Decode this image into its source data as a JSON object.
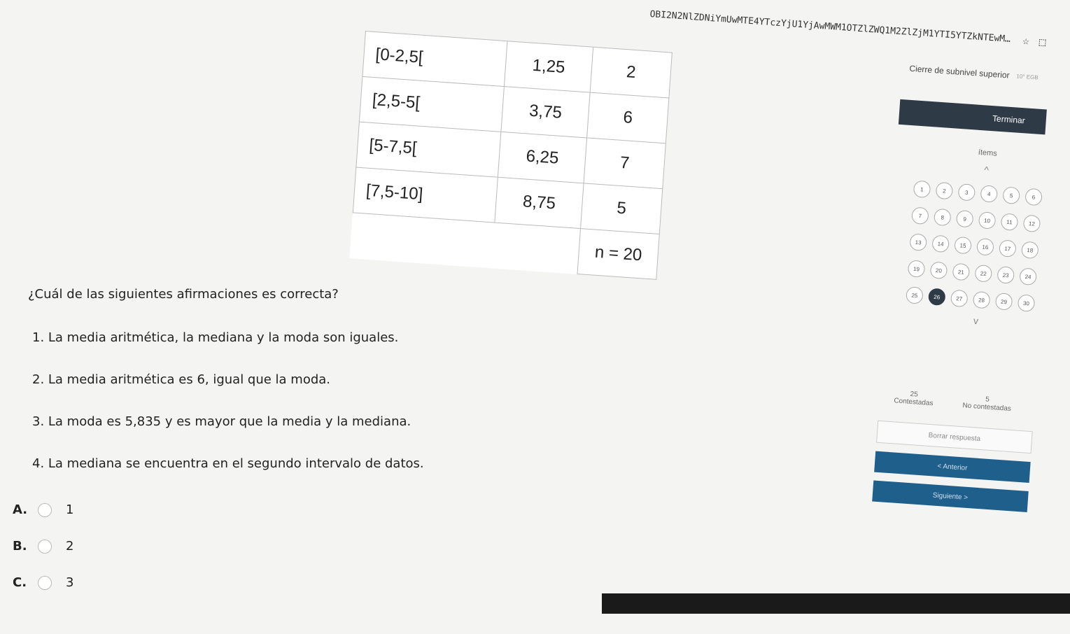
{
  "browser": {
    "url": "OBI2N2NlZDNiYmUwMTE4YTczYjU1YjAwMWM1OTZlZWQ1M2ZlZjM1YTI5YTZkNTEwMDk..."
  },
  "table": {
    "rows": [
      {
        "interval": "[0-2,5[",
        "mark": "1,25",
        "freq": "2"
      },
      {
        "interval": "[2,5-5[",
        "mark": "3,75",
        "freq": "6"
      },
      {
        "interval": "[5-7,5[",
        "mark": "6,25",
        "freq": "7"
      },
      {
        "interval": "[7,5-10]",
        "mark": "8,75",
        "freq": "5"
      }
    ],
    "total": "n = 20"
  },
  "question": {
    "prompt": "¿Cuál de las siguientes afirmaciones es correcta?",
    "statements": [
      "1. La media aritmética, la mediana y la moda son iguales.",
      "2. La media aritmética es 6, igual que la moda.",
      "3. La moda es 5,835 y es mayor que la media y la mediana.",
      "4. La mediana se encuentra en el segundo intervalo de datos."
    ],
    "options": [
      {
        "letter": "A.",
        "value": "1"
      },
      {
        "letter": "B.",
        "value": "2"
      },
      {
        "letter": "C.",
        "value": "3"
      }
    ]
  },
  "panel": {
    "subnivel": "Cierre de subnivel superior",
    "grade": "10° EGB",
    "finish_label": "Terminar",
    "items_label": "ítems",
    "numbers": [
      "1",
      "2",
      "3",
      "4",
      "5",
      "6",
      "7",
      "8",
      "9",
      "10",
      "11",
      "12",
      "13",
      "14",
      "15",
      "16",
      "17",
      "18",
      "19",
      "20",
      "21",
      "22",
      "23",
      "24",
      "25",
      "26",
      "27",
      "28",
      "29",
      "30"
    ],
    "current": "26",
    "answered_count": "25",
    "answered_label": "Contestadas",
    "unanswered_count": "5",
    "unanswered_label": "No contestadas",
    "clear_label": "Borrar respuesta",
    "prev_label": "< Anterior",
    "next_label": "Siguiente >"
  }
}
